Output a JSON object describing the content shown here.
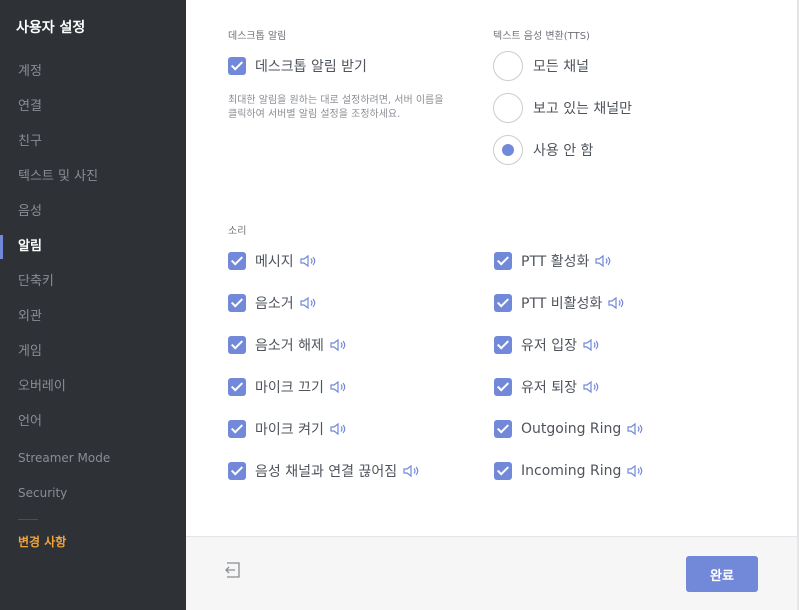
{
  "sidebar": {
    "title": "사용자 설정",
    "items": [
      {
        "label": "계정"
      },
      {
        "label": "연결"
      },
      {
        "label": "친구"
      },
      {
        "label": "텍스트 및 사진"
      },
      {
        "label": "음성"
      },
      {
        "label": "알림"
      },
      {
        "label": "단축키"
      },
      {
        "label": "외관"
      },
      {
        "label": "게임"
      },
      {
        "label": "오버레이"
      },
      {
        "label": "언어"
      },
      {
        "label": "Streamer Mode"
      },
      {
        "label": "Security"
      }
    ],
    "active_item": "알림",
    "changes_label": "변경 사항"
  },
  "desktop_notifications": {
    "section_label": "데스크톱 알림",
    "checkbox_label": "데스크톱 알림 받기",
    "checked": true,
    "description_line1": "최대한 알림을 원하는 대로 설정하려면, 서버 이름을",
    "description_line2": "클릭하여 서버별 알림 설정을 조정하세요."
  },
  "tts": {
    "section_label": "텍스트 음성 변환(TTS)",
    "options": [
      {
        "label": "모든 채널",
        "selected": false
      },
      {
        "label": "보고 있는 채널만",
        "selected": false
      },
      {
        "label": "사용 안 함",
        "selected": true
      }
    ]
  },
  "sounds": {
    "section_label": "소리",
    "left": [
      {
        "label": "메시지",
        "checked": true
      },
      {
        "label": "음소거",
        "checked": true
      },
      {
        "label": "음소거 해제",
        "checked": true
      },
      {
        "label": "마이크 끄기",
        "checked": true
      },
      {
        "label": "마이크 켜기",
        "checked": true
      },
      {
        "label": "음성 채널과 연결 끊어짐",
        "checked": true
      }
    ],
    "right": [
      {
        "label": "PTT 활성화",
        "checked": true
      },
      {
        "label": "PTT 비활성화",
        "checked": true
      },
      {
        "label": "유저 입장",
        "checked": true
      },
      {
        "label": "유저 퇴장",
        "checked": true
      },
      {
        "label": "Outgoing Ring",
        "checked": true
      },
      {
        "label": "Incoming Ring",
        "checked": true
      }
    ]
  },
  "footer": {
    "done_label": "완료",
    "back_icon": "exit-arrow-icon"
  },
  "colors": {
    "accent": "#7289da",
    "sidebar_bg": "#2e3136",
    "changes": "#f0a43c"
  }
}
